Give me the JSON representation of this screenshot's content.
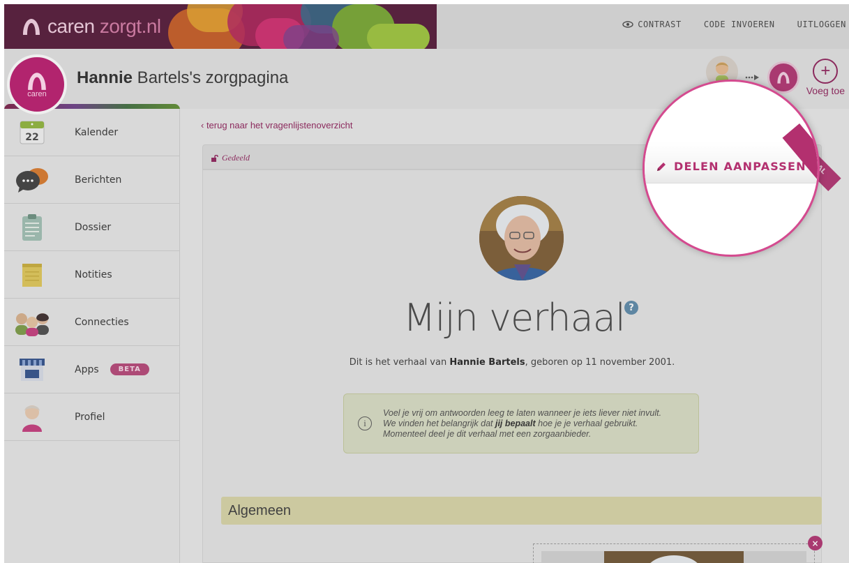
{
  "app": {
    "logo_brand": "caren",
    "logo_suffix": "zorgt.nl",
    "avatar_label": "caren"
  },
  "topnav": {
    "contrast": "CONTRAST",
    "code": "CODE INVOEREN",
    "logout": "UITLOGGEN"
  },
  "header": {
    "first_name": "Hannie",
    "rest_title": " Bartels's zorgpagina",
    "add_label": "Voeg toe",
    "partial_label": "Il"
  },
  "sidebar": {
    "items": [
      {
        "label": "Kalender",
        "icon": "calendar-icon",
        "date": "22"
      },
      {
        "label": "Berichten",
        "icon": "chat-icon"
      },
      {
        "label": "Dossier",
        "icon": "clipboard-icon"
      },
      {
        "label": "Notities",
        "icon": "notepad-icon"
      },
      {
        "label": "Connecties",
        "icon": "people-icon"
      },
      {
        "label": "Apps",
        "icon": "store-icon",
        "badge": "BETA"
      },
      {
        "label": "Profiel",
        "icon": "profile-icon"
      }
    ]
  },
  "main": {
    "back_link": "‹ terug naar het vragenlijstenoverzicht",
    "shared_label": "Gedeeld",
    "title": "Mijn verhaal",
    "help": "?",
    "intro_prefix": "Dit is het verhaal van ",
    "intro_name": "Hannie Bartels",
    "intro_suffix": ", geboren op 11 november 2001.",
    "info_part1": "Voel je vrij om antwoorden leeg te laten wanneer je iets liever niet invult. We vinden het belangrijk dat ",
    "info_bold": "jij bepaalt",
    "info_part2": " hoe je je verhaal gebruikt. Momenteel deel je dit verhaal met een zorgaanbieder.",
    "section_title": "Algemeen",
    "ribbon_text": "AL",
    "close": "×"
  },
  "magnifier": {
    "edit_sharing": "DELEN AANPASSEN"
  },
  "colors": {
    "brand": "#b0306f",
    "link": "#8e1f59",
    "info_bg": "#d8dcc3",
    "section_bg": "#d8d4a5"
  }
}
